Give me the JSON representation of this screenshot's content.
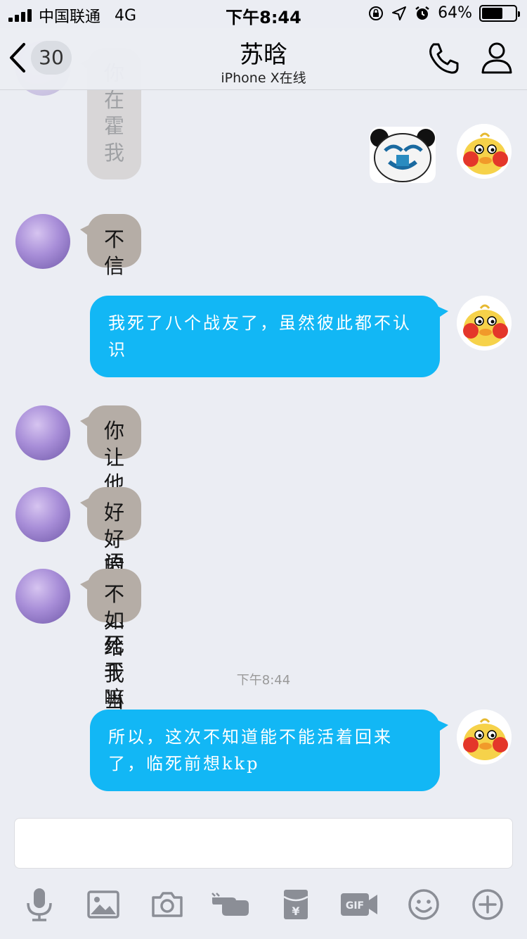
{
  "status_bar": {
    "carrier": "中国联通",
    "network": "4G",
    "time": "下午8:44",
    "battery": "64%",
    "battery_level": 0.64
  },
  "nav": {
    "unread_count": "30",
    "title": "苏晗",
    "subtitle": "iPhone X在线",
    "icons": [
      "back-chevron-icon",
      "phone-icon",
      "profile-icon"
    ]
  },
  "messages": [
    {
      "side": "left",
      "type": "text",
      "text": "你在霍我",
      "partial": true
    },
    {
      "side": "right",
      "type": "sticker",
      "sticker": "panda-face-sticker"
    },
    {
      "side": "left",
      "type": "text",
      "text": "不信"
    },
    {
      "side": "right",
      "type": "text",
      "text": "我死了八个战友了，虽然彼此都不认识"
    },
    {
      "side": "left",
      "type": "text",
      "text": "你让他录个语音"
    },
    {
      "side": "left",
      "type": "text",
      "text": "好好的去送死干嘛"
    },
    {
      "side": "left",
      "type": "text",
      "text": "不如给我当后期"
    },
    {
      "side": "right",
      "type": "text",
      "text": "所以，这次不知道能不能活着回来了，临死前想kkp"
    }
  ],
  "timestamp": "下午8:44",
  "input": {
    "placeholder": ""
  },
  "toolbar": [
    "microphone-icon",
    "image-icon",
    "camera-icon",
    "poke-hand-icon",
    "red-packet-icon",
    "gif-icon",
    "emoji-icon",
    "plus-icon"
  ],
  "colors": {
    "background": "#ebedf3",
    "bubble_blue": "#12b7f5",
    "bubble_gray": "#b5ada6"
  }
}
